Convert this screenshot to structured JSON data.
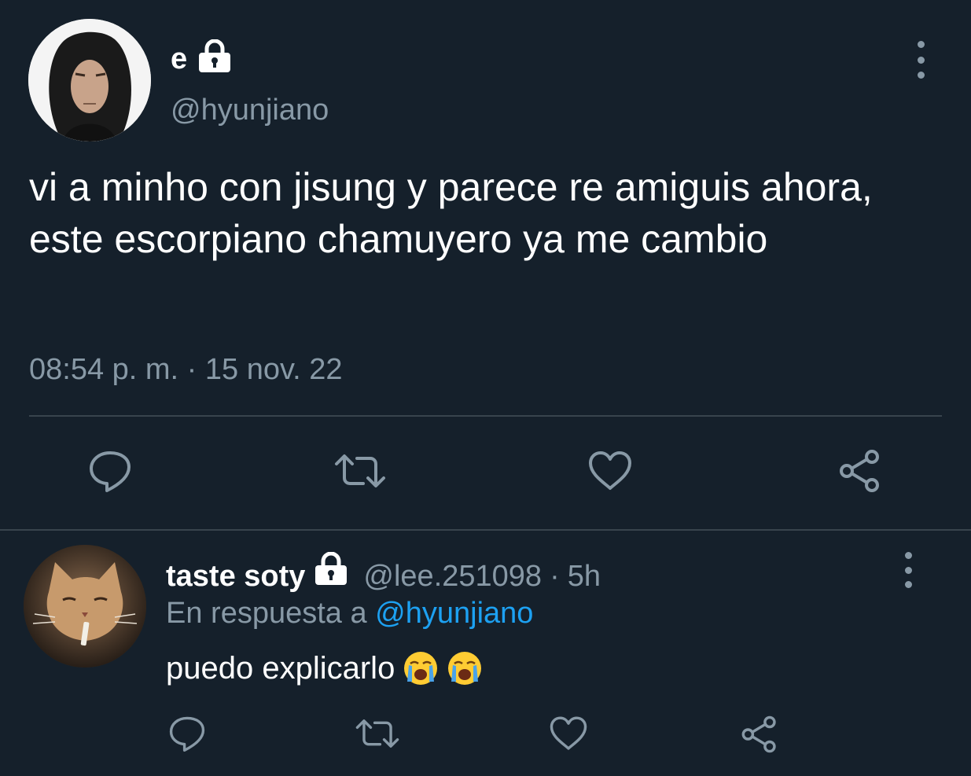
{
  "main_tweet": {
    "display_name": "e",
    "handle": "@hyunjiano",
    "text": "vi a minho con jisung y parece re amiguis ahora, este escorpiano chamuyero ya me cambio",
    "timestamp": "08:54 p. m. · 15 nov. 22",
    "protected_icon": "lock-icon",
    "actions": [
      "reply-icon",
      "retweet-icon",
      "like-icon",
      "share-icon"
    ]
  },
  "reply": {
    "display_name": "taste soty",
    "handle": "@lee.251098",
    "separator": "·",
    "time": "5h",
    "reply_prefix": "En respuesta a",
    "reply_mention": "@hyunjiano",
    "text": "puedo explicarlo",
    "emojis": [
      "loudly-crying-face-icon",
      "loudly-crying-face-icon"
    ],
    "protected_icon": "lock-icon",
    "actions": [
      "reply-icon",
      "retweet-icon",
      "like-icon",
      "share-icon"
    ]
  },
  "colors": {
    "background": "#15202b",
    "primary_text": "#ffffff",
    "secondary_text": "#8899a6",
    "link": "#1da1f2",
    "divider": "#38444d"
  }
}
